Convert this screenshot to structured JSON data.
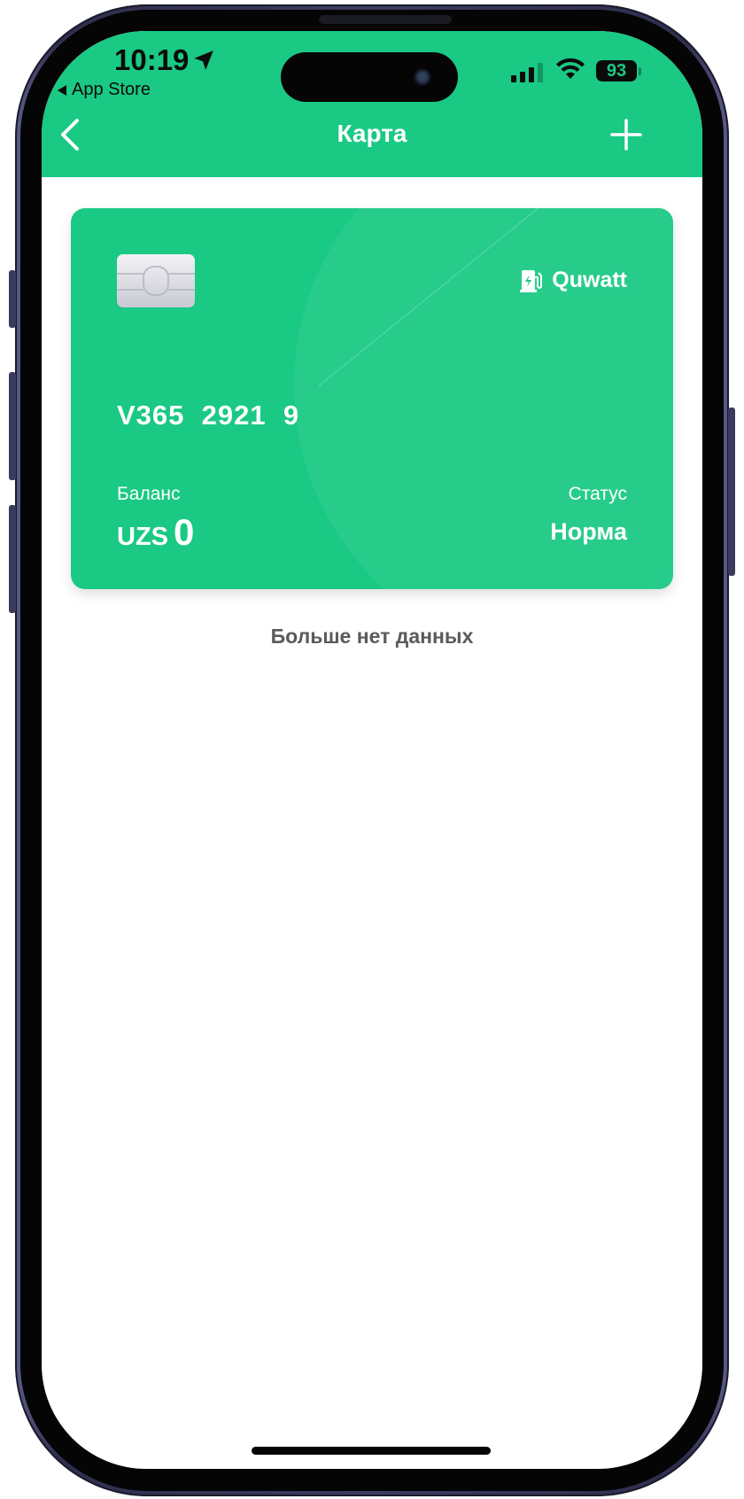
{
  "status_bar": {
    "time": "10:19",
    "back_app": "App Store",
    "battery": "93"
  },
  "nav": {
    "title": "Карта"
  },
  "card": {
    "brand": "Quwatt",
    "number": "V365  2921  9",
    "balance_label": "Баланс",
    "currency": "UZS",
    "balance": "0",
    "status_label": "Статус",
    "status": "Норма"
  },
  "empty_text": "Больше нет данных",
  "colors": {
    "accent": "#1ac984",
    "card": "#1ac984"
  },
  "icons": {
    "back": "chevron-left-icon",
    "add": "plus-icon",
    "brand": "ev-charger-icon",
    "chip": "card-chip-icon"
  }
}
